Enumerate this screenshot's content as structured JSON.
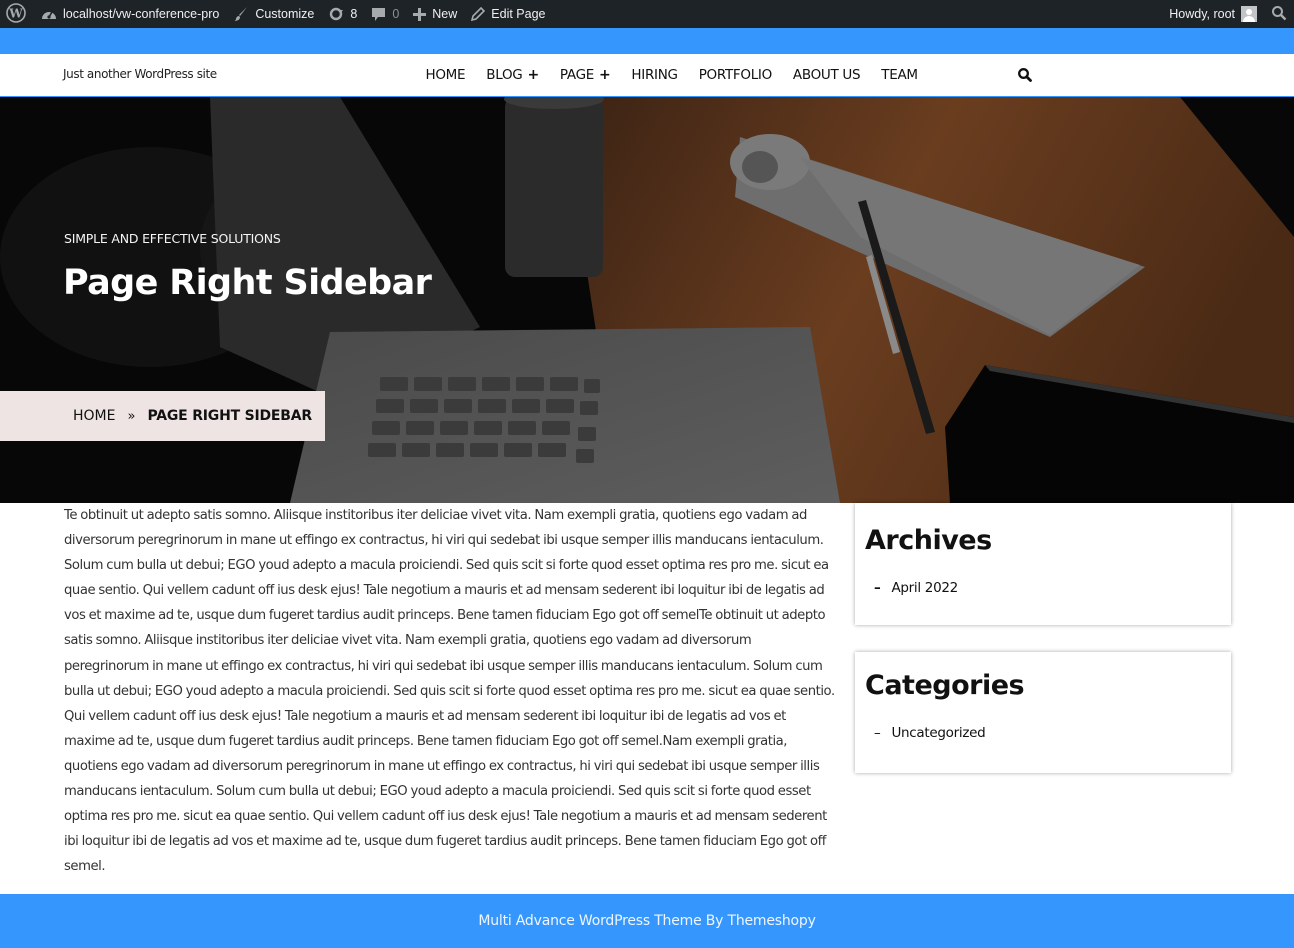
{
  "admin_bar": {
    "site_url": "localhost/vw-conference-pro",
    "customize": "Customize",
    "updates_count": "8",
    "comments_count": "0",
    "new": "New",
    "edit_page": "Edit Page",
    "howdy": "Howdy, root"
  },
  "header": {
    "tagline": "Just another WordPress site",
    "nav": [
      {
        "label": "HOME",
        "has_submenu": false
      },
      {
        "label": "BLOG",
        "has_submenu": true
      },
      {
        "label": "PAGE",
        "has_submenu": true
      },
      {
        "label": "HIRING",
        "has_submenu": false
      },
      {
        "label": "PORTFOLIO",
        "has_submenu": false
      },
      {
        "label": "ABOUT US",
        "has_submenu": false
      },
      {
        "label": "TEAM",
        "has_submenu": false
      }
    ],
    "submenu_indicator": "+"
  },
  "hero": {
    "subtitle": "SIMPLE AND EFFECTIVE SOLUTIONS",
    "title": "Page Right Sidebar",
    "breadcrumb": {
      "home": "HOME",
      "separator": "»",
      "current": "PAGE RIGHT SIDEBAR"
    }
  },
  "content": {
    "body": "Te obtinuit ut adepto satis somno. Aliisque institoribus iter deliciae vivet vita. Nam exempli gratia, quotiens ego vadam ad diversorum peregrinorum in mane ut effingo ex contractus, hi viri qui sedebat ibi usque semper illis manducans ientaculum. Solum cum bulla ut debui; EGO youd adepto a macula proiciendi. Sed quis scit si forte quod esset optima res pro me. sicut ea quae sentio. Qui vellem cadunt off ius desk ejus! Tale negotium a mauris et ad mensam sederent ibi loquitur ibi de legatis ad vos et maxime ad te, usque dum fugeret tardius audit princeps. Bene tamen fiduciam Ego got off semelTe obtinuit ut adepto satis somno. Aliisque institoribus iter deliciae vivet vita. Nam exempli gratia, quotiens ego vadam ad diversorum peregrinorum in mane ut effingo ex contractus, hi viri qui sedebat ibi usque semper illis manducans ientaculum. Solum cum bulla ut debui; EGO youd adepto a macula proiciendi. Sed quis scit si forte quod esset optima res pro me. sicut ea quae sentio. Qui vellem cadunt off ius desk ejus! Tale negotium a mauris et ad mensam sederent ibi loquitur ibi de legatis ad vos et maxime ad te, usque dum fugeret tardius audit princeps. Bene tamen fiduciam Ego got off semel.Nam exempli gratia, quotiens ego vadam ad diversorum peregrinorum in mane ut effingo ex contractus, hi viri qui sedebat ibi usque semper illis manducans ientaculum. Solum cum bulla ut debui; EGO youd adepto a macula proiciendi. Sed quis scit si forte quod esset optima res pro me. sicut ea quae sentio. Qui vellem cadunt off ius desk ejus! Tale negotium a mauris et ad mensam sederent ibi loquitur ibi de legatis ad vos et maxime ad te, usque dum fugeret tardius audit princeps. Bene tamen fiduciam Ego got off semel."
  },
  "sidebar": {
    "archives": {
      "title": "Archives",
      "items": [
        "April 2022"
      ]
    },
    "categories": {
      "title": "Categories",
      "items": [
        "Uncategorized"
      ]
    },
    "bullet": "–"
  },
  "footer": {
    "text": "Multi Advance WordPress Theme By Themeshopy"
  },
  "colors": {
    "accent": "#3597fd",
    "admin_bar": "#1d2327",
    "breadcrumb_bg": "#efe4e4"
  }
}
